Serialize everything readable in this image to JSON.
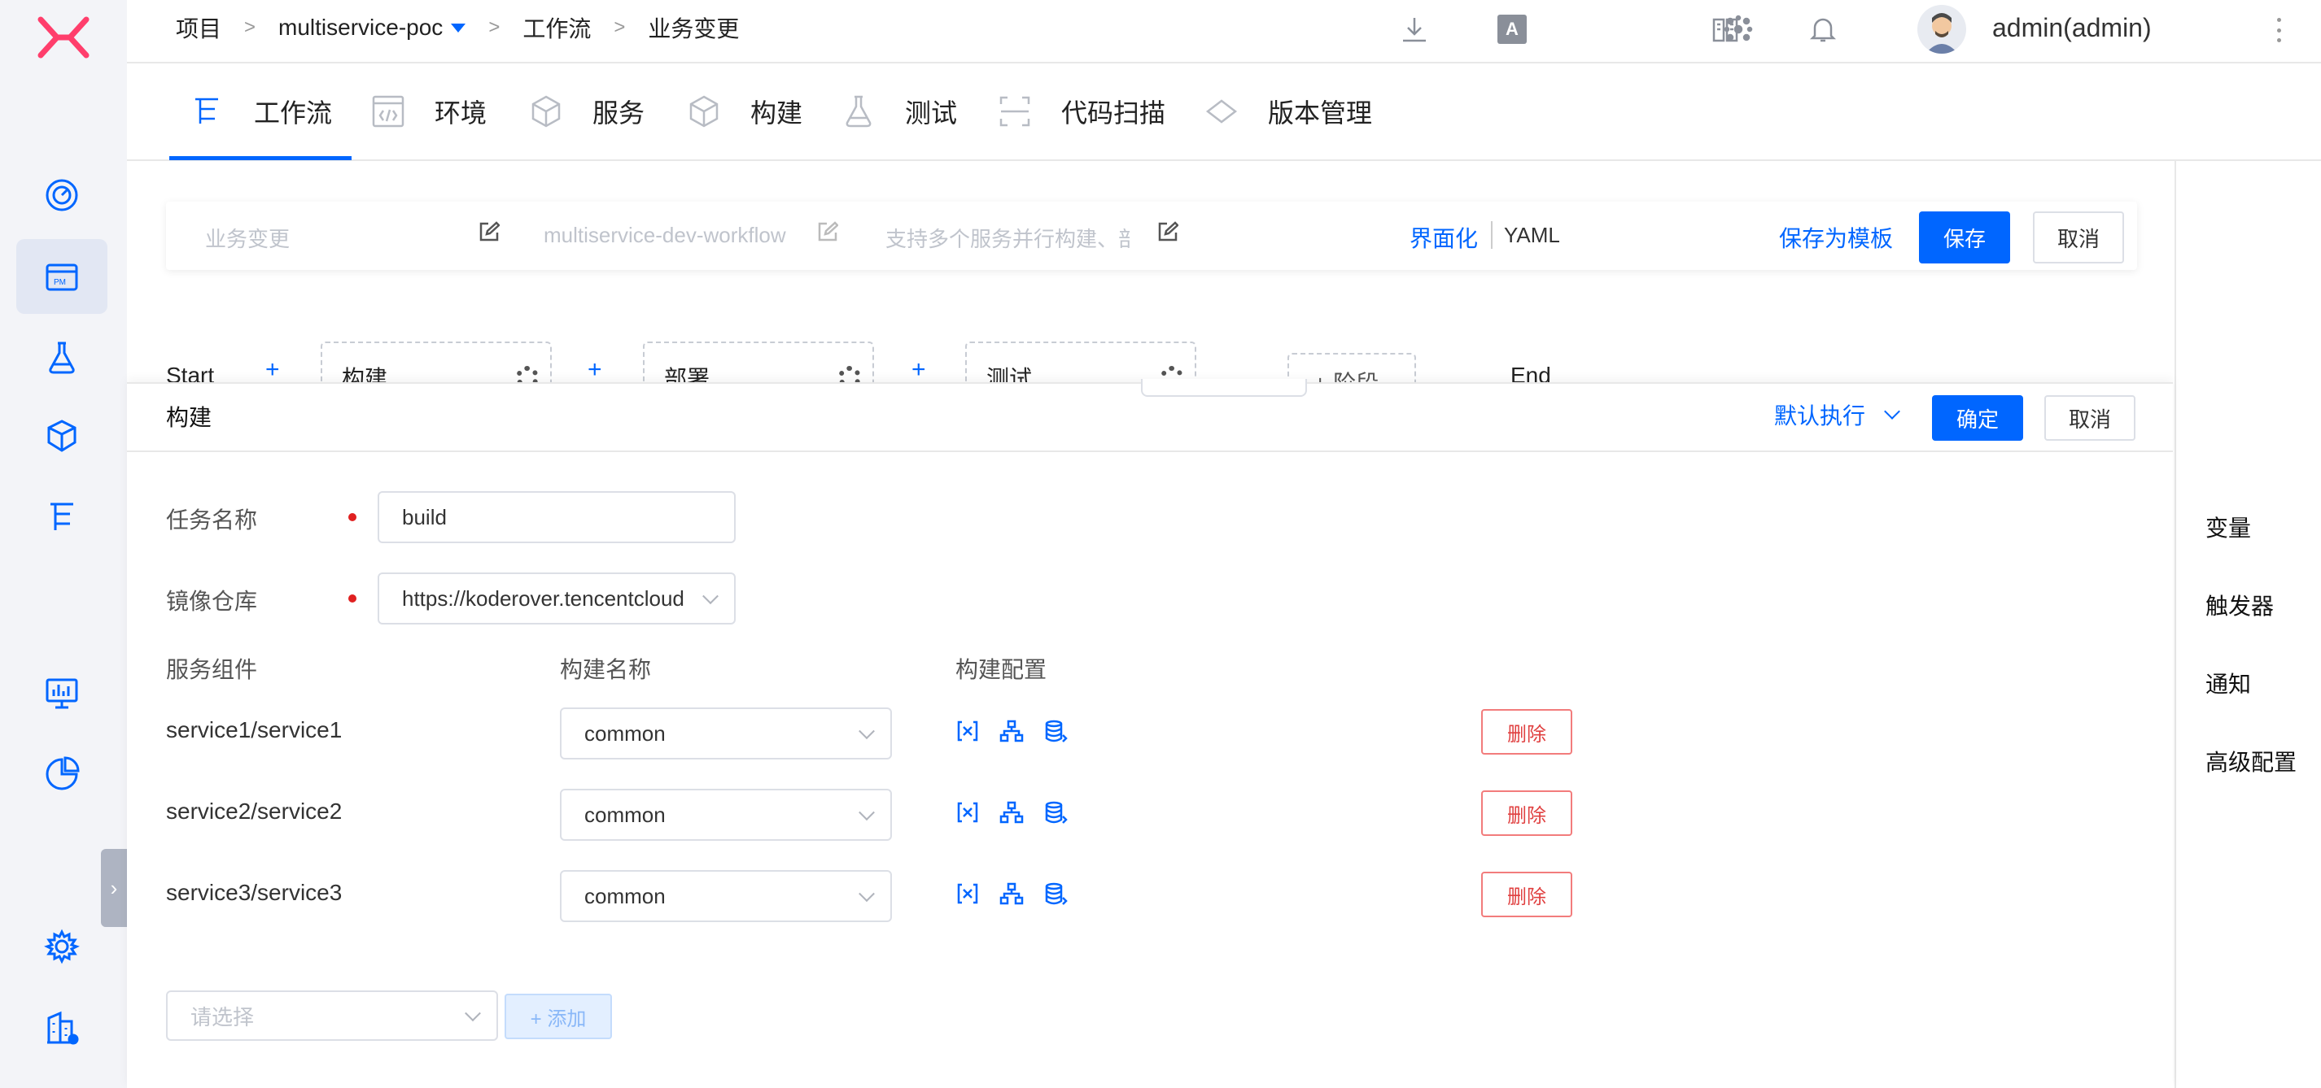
{
  "header": {
    "breadcrumb": {
      "project_label": "项目",
      "sep": ">",
      "project_name": "multiservice-poc",
      "workflow_label": "工作流",
      "current": "业务变更"
    },
    "user": "admin(admin)",
    "icons": [
      "download-icon",
      "translate-icon",
      "cluster-icon",
      "book-icon",
      "bell-icon",
      "avatar",
      "more-vertical-icon"
    ]
  },
  "tabs": [
    {
      "label": "工作流",
      "icon": "workflow-icon",
      "active": true
    },
    {
      "label": "环境",
      "icon": "code-icon"
    },
    {
      "label": "服务",
      "icon": "cube-icon"
    },
    {
      "label": "构建",
      "icon": "box-icon"
    },
    {
      "label": "测试",
      "icon": "flask-icon"
    },
    {
      "label": "代码扫描",
      "icon": "scan-icon"
    },
    {
      "label": "版本管理",
      "icon": "diamond-icon"
    }
  ],
  "workflow": {
    "display_name": "业务变更",
    "key": "multiservice-dev-workflow",
    "description": "支持多个服务并行构建、部署",
    "mode_ui": "界面化",
    "mode_yaml": "YAML",
    "save_template": "保存为模板",
    "save": "保存",
    "cancel": "取消"
  },
  "pipeline": {
    "start": "Start",
    "stages": [
      "构建",
      "部署",
      "测试"
    ],
    "add_stage": "+ 阶段",
    "end": "End",
    "plus": "+"
  },
  "right_panel": [
    "变量",
    "触发器",
    "通知",
    "高级配置"
  ],
  "drawer": {
    "title": "构建",
    "exec_mode": "默认执行",
    "confirm": "确定",
    "cancel": "取消",
    "task_name_label": "任务名称",
    "task_name_value": "build",
    "registry_label": "镜像仓库",
    "registry_value": "https://koderover.tencentcloudcr.com",
    "columns": [
      "服务组件",
      "构建名称",
      "构建配置"
    ],
    "rows": [
      {
        "service": "service1/service1",
        "build": "common",
        "delete": "删除"
      },
      {
        "service": "service2/service2",
        "build": "common",
        "delete": "删除"
      },
      {
        "service": "service3/service3",
        "build": "common",
        "delete": "删除"
      }
    ],
    "select_placeholder": "请选择",
    "add_button": "+ 添加"
  },
  "colors": {
    "primary": "#0066ff",
    "danger": "#e04040",
    "sidebar_bg": "#f3f4f8"
  }
}
